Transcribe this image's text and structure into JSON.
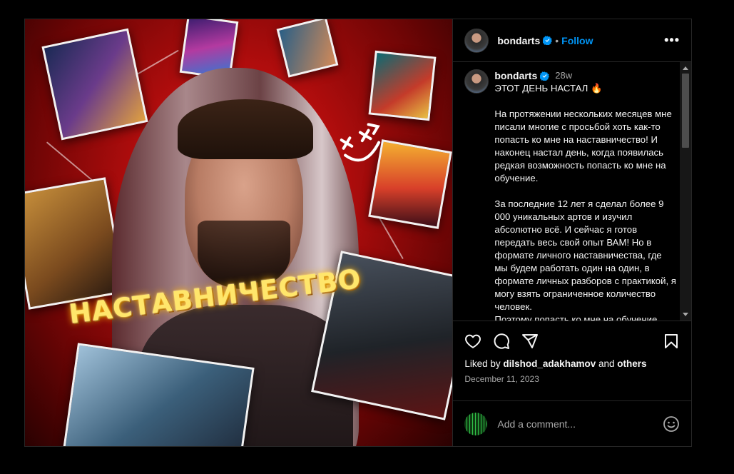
{
  "post": {
    "username": "bondarts",
    "follow_label": "Follow",
    "dot": "•",
    "more_label": "•••"
  },
  "media": {
    "overlay_text": "НАСТАВНИЧЕСТВО"
  },
  "caption": {
    "username": "bondarts",
    "time": "28w",
    "title": "ЭТОТ ДЕНЬ НАСТАЛ 🔥",
    "paragraph1": "На протяжении нескольких месяцев мне писали многие с просьбой хоть как-то попасть ко мне на наставничество! И наконец настал день, когда появилась редкая возможность попасть ко мне на обучение.",
    "paragraph2": "За последние 12 лет я сделал более 9 000 уникальных артов и изучил абсолютно всё. И сейчас я готов передать весь свой опыт ВАМ! Но в формате личного наставничества, где мы будем работать один на один, в формате личных разборов с практикой, я могу взять ограниченное количество человек.",
    "paragraph3": "Поэтому попасть ко мне на обучение"
  },
  "engagement": {
    "liked_by_prefix": "Liked by",
    "liked_by_user": "dilshod_adakhamov",
    "and_label": "and",
    "others_label": "others",
    "date": "December 11, 2023"
  },
  "comment": {
    "placeholder": "Add a comment..."
  },
  "colors": {
    "accent": "#0095f6",
    "verified": "#0095f6",
    "background": "#000000"
  },
  "icons": [
    "verified-icon",
    "more-icon",
    "like-icon",
    "comment-icon",
    "share-icon",
    "bookmark-icon",
    "emoji-icon"
  ]
}
